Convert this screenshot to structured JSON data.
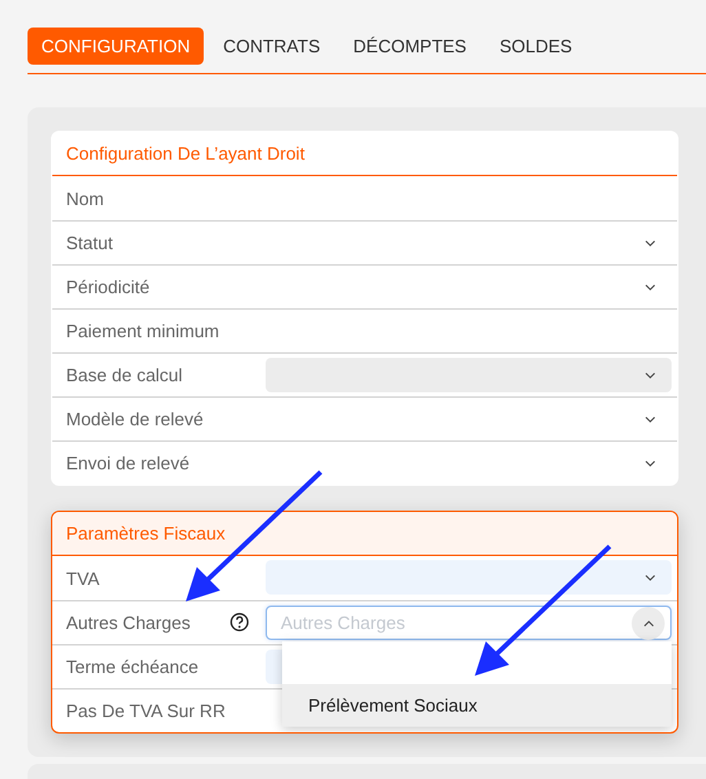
{
  "tabs": [
    {
      "label": "CONFIGURATION",
      "selected": true
    },
    {
      "label": "CONTRATS",
      "selected": false
    },
    {
      "label": "DÉCOMPTES",
      "selected": false
    },
    {
      "label": "SOLDES",
      "selected": false
    }
  ],
  "cards": [
    {
      "title": "Configuration De L’ayant Droit",
      "highlighted": false,
      "rows": [
        {
          "label": "Nom",
          "kind": "text"
        },
        {
          "label": "Statut",
          "kind": "select"
        },
        {
          "label": "Périodicité",
          "kind": "select"
        },
        {
          "label": "Paiement minimum",
          "kind": "text"
        },
        {
          "label": "Base de calcul",
          "kind": "select",
          "disabled": true
        },
        {
          "label": "Modèle de relevé",
          "kind": "select"
        },
        {
          "label": "Envoi de relevé",
          "kind": "select"
        }
      ]
    },
    {
      "title": "Paramètres Fiscaux",
      "highlighted": true,
      "rows": [
        {
          "label": "TVA",
          "kind": "select",
          "filled": true
        },
        {
          "label": "Autres Charges",
          "kind": "select",
          "help": true,
          "expanded": true,
          "placeholder": "Autres Charges",
          "options": [
            {
              "label": "Prélèvement Sociaux",
              "selected": true
            }
          ]
        },
        {
          "label": "Terme échéance",
          "kind": "select",
          "filled": true
        },
        {
          "label": "Pas De TVA Sur RR",
          "kind": "plain"
        }
      ]
    }
  ]
}
